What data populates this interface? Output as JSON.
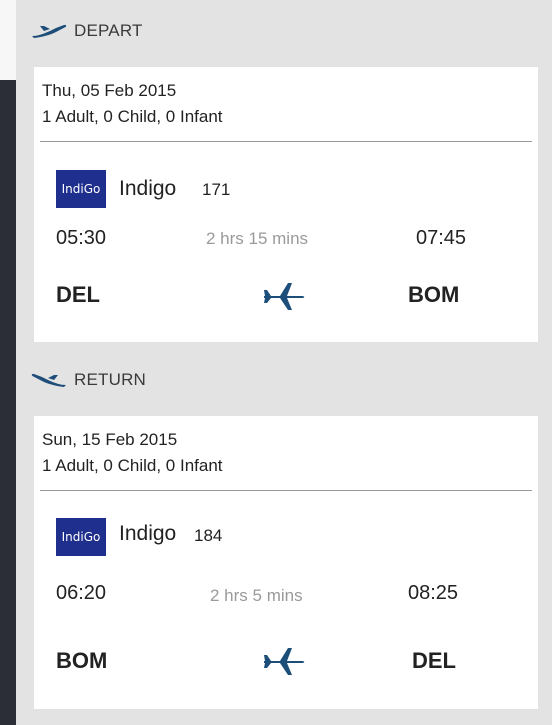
{
  "depart": {
    "label": "DEPART",
    "date": "Thu, 05 Feb 2015",
    "pax": "1 Adult, 0 Child, 0 Infant",
    "logo_text": "IndiGo",
    "airline": "Indigo",
    "flight_no": "171",
    "dep_time": "05:30",
    "duration": "2 hrs 15 mins",
    "arr_time": "07:45",
    "from": "DEL",
    "to": "BOM"
  },
  "return": {
    "label": "RETURN",
    "date": "Sun, 15 Feb 2015",
    "pax": "1 Adult, 0 Child, 0 Infant",
    "logo_text": "IndiGo",
    "airline": "Indigo",
    "flight_no": "184",
    "dep_time": "06:20",
    "duration": "2 hrs 5 mins",
    "arr_time": "08:25",
    "from": "BOM",
    "to": "DEL"
  },
  "colors": {
    "accent": "#f39c12",
    "logo_bg": "#1f2f8e",
    "icon": "#1d4e7a"
  }
}
